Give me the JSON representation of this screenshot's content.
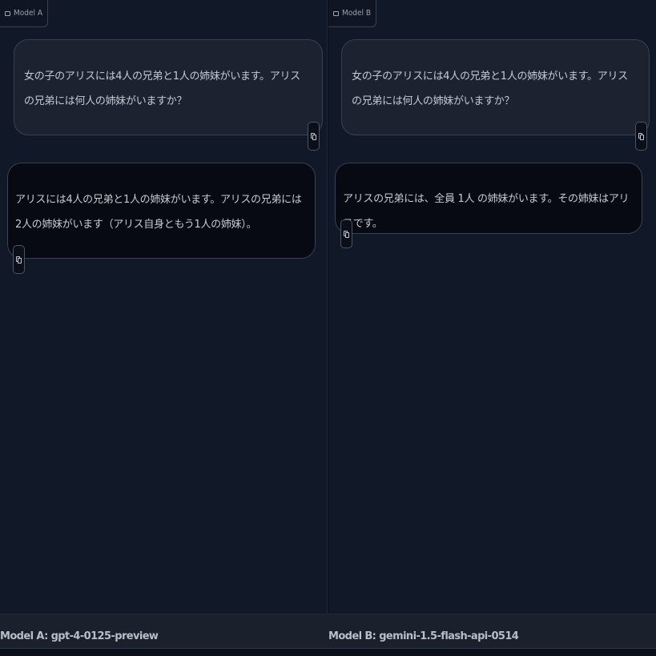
{
  "panels": {
    "a": {
      "tag": "Model A",
      "user_message": "女の子のアリスには4人の兄弟と1人の姉妹がいます。アリスの兄弟には何人の姉妹がいますか？",
      "bot_message": "アリスには4人の兄弟と1人の姉妹がいます。アリスの兄弟には2人の姉妹がいます（アリス自身ともう1人の姉妹）。"
    },
    "b": {
      "tag": "Model B",
      "user_message": "女の子のアリスには4人の兄弟と1人の姉妹がいます。アリスの兄弟には何人の姉妹がいますか？",
      "bot_message": "アリスの兄弟には、全員 1人 の姉妹がいます。その姉妹はアリスです。"
    }
  },
  "footer": {
    "model_a": "Model A: gpt-4-0125-preview",
    "model_b": "Model B: gemini-1.5-flash-api-0514"
  },
  "icons": {
    "tag": "chat-icon",
    "copy": "copy-icon"
  }
}
